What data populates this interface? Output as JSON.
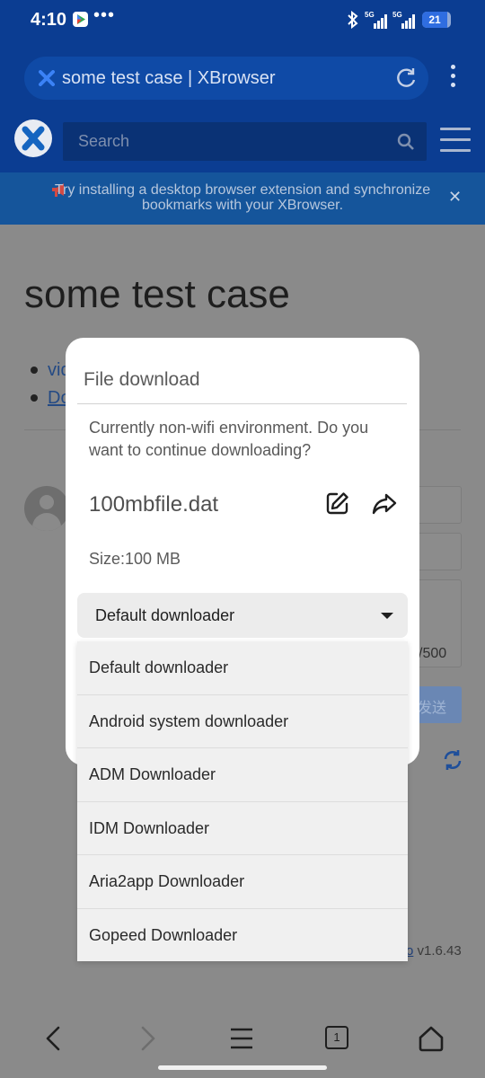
{
  "status_bar": {
    "time": "4:10",
    "dots": "•••",
    "network1": "5G",
    "network2": "5G",
    "battery": "21"
  },
  "browser": {
    "url_text": "some test case | XBrowser",
    "search_placeholder": "Search",
    "banner_text": "Try installing a desktop browser extension and synchronize bookmarks with your XBrowser.",
    "banner_close": "✕",
    "tab_count": "1"
  },
  "page": {
    "title": "some test case",
    "list_items": [
      "vid",
      "Do"
    ],
    "counter_text": "/500",
    "send_label": "发送",
    "version_link": "o",
    "version_text": " v1.6.43"
  },
  "dialog": {
    "title": "File download",
    "message": "Currently non-wifi environment. Do you want to continue downloading?",
    "filename": "100mbfile.dat",
    "size": "Size:100 MB",
    "selected_downloader": "Default downloader",
    "downloader_options": [
      "Default downloader",
      "Android system downloader",
      "ADM Downloader",
      "IDM Downloader",
      "Aria2app Downloader",
      "Gopeed Downloader"
    ]
  },
  "colors": {
    "chrome": "#0b3d92",
    "banner": "#15559b",
    "overlay_page": "#8a8a8a",
    "accent_link": "#1f4f9a"
  }
}
